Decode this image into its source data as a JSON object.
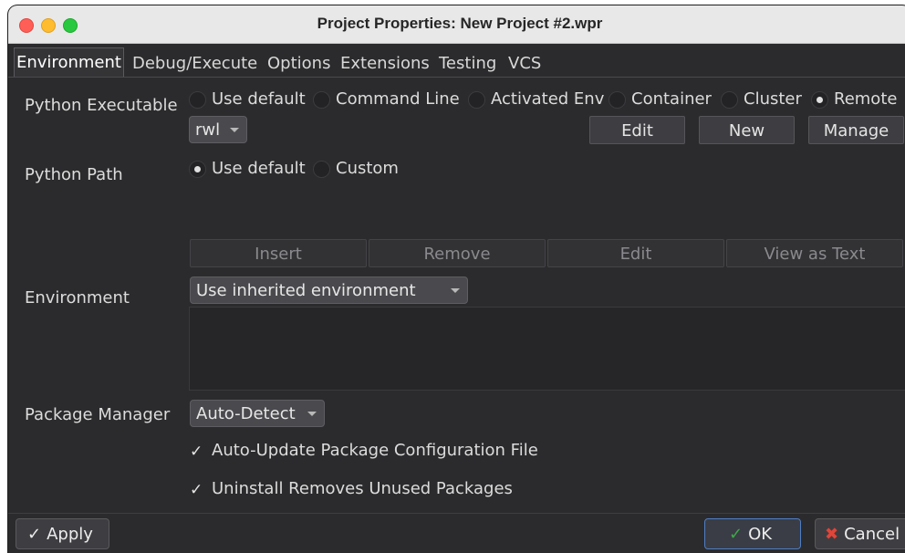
{
  "window": {
    "title": "Project Properties: New Project #2.wpr"
  },
  "tabs": [
    {
      "label": "Environment",
      "active": true
    },
    {
      "label": "Debug/Execute"
    },
    {
      "label": "Options"
    },
    {
      "label": "Extensions"
    },
    {
      "label": "Testing"
    },
    {
      "label": "VCS"
    }
  ],
  "python_executable": {
    "label": "Python Executable",
    "options": [
      "Use default",
      "Command Line",
      "Activated Env",
      "Container",
      "Cluster",
      "Remote"
    ],
    "selected": "Remote",
    "host_value": "rwl",
    "edit_label": "Edit",
    "new_label": "New",
    "manage_label": "Manage"
  },
  "python_path": {
    "label": "Python Path",
    "options": [
      "Use default",
      "Custom"
    ],
    "selected": "Use default",
    "insert_label": "Insert",
    "remove_label": "Remove",
    "edit_label": "Edit",
    "view_as_text_label": "View as Text"
  },
  "environment": {
    "label": "Environment",
    "selected": "Use inherited environment"
  },
  "package_manager": {
    "label": "Package Manager",
    "selected": "Auto-Detect",
    "auto_update_label": "Auto-Update Package Configuration File",
    "auto_update_checked": true,
    "uninstall_label": "Uninstall Removes Unused Packages",
    "uninstall_checked": true
  },
  "footer": {
    "apply_label": "Apply",
    "ok_label": "OK",
    "cancel_label": "Cancel"
  },
  "icons": {
    "apply": "check-icon",
    "ok": "check-icon",
    "cancel": "x-icon"
  }
}
